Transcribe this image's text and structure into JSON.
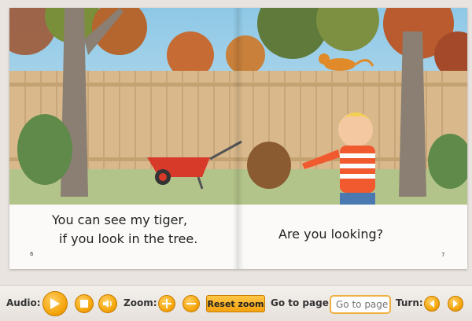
{
  "book": {
    "left_page": {
      "lines": [
        "You can see my tiger,",
        "if you look in the tree."
      ],
      "page_number": "6"
    },
    "right_page": {
      "lines": [
        "Are you looking?"
      ],
      "page_number": "7"
    }
  },
  "toolbar": {
    "audio_label": "Audio:",
    "zoom_label": "Zoom:",
    "reset_zoom_label": "Reset zoom",
    "goto_label": "Go to page:",
    "goto_placeholder": "Go to page",
    "turn_label": "Turn:"
  },
  "icons": {
    "play": "play-icon",
    "stop": "stop-icon",
    "volume": "volume-icon",
    "zoom_in": "plus-icon",
    "zoom_out": "minus-icon",
    "prev": "chevron-left-icon",
    "next": "chevron-right-icon"
  },
  "colors": {
    "accent": "#f5a70e",
    "page_background": "#fbfaf8",
    "toolbar_background": "#ece8e3"
  }
}
